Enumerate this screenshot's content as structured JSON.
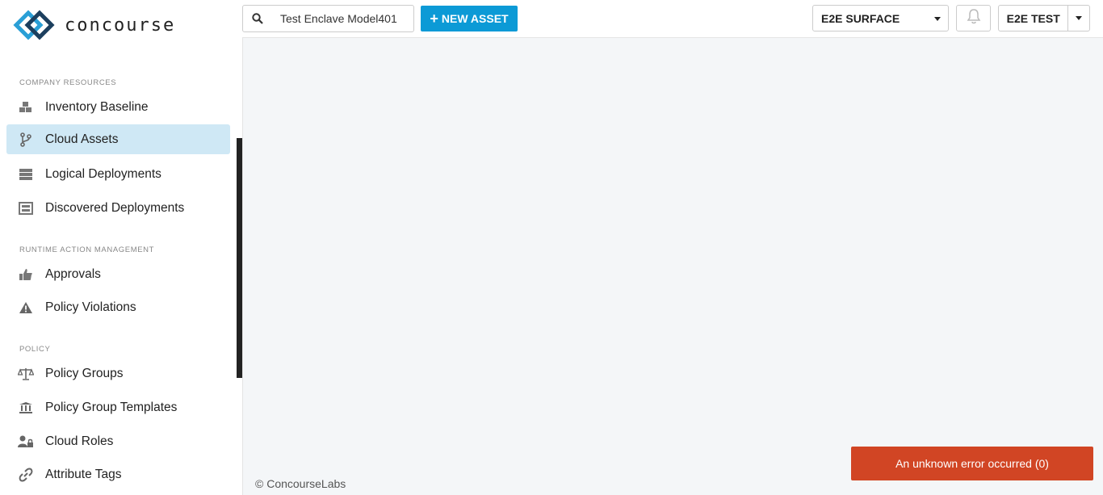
{
  "app": {
    "logo_text": "concourse"
  },
  "header": {
    "search_value": "Test Enclave Model401",
    "new_asset_label": "NEW ASSET",
    "surface_label": "E2E SURFACE",
    "user_label": "E2E TEST"
  },
  "sidebar": {
    "sections": {
      "company_resources": "COMPANY RESOURCES",
      "runtime_action_management": "RUNTIME ACTION MANAGEMENT",
      "policy": "POLICY"
    },
    "items": [
      {
        "label": "Inventory Baseline",
        "icon": "cubes-icon"
      },
      {
        "label": "Cloud Assets",
        "icon": "branch-icon",
        "active": true
      },
      {
        "label": "Logical Deployments",
        "icon": "server-icon"
      },
      {
        "label": "Discovered Deployments",
        "icon": "scan-icon"
      },
      {
        "label": "Approvals",
        "icon": "thumbs-up-icon"
      },
      {
        "label": "Policy Violations",
        "icon": "warning-icon"
      },
      {
        "label": "Policy Groups",
        "icon": "scale-icon"
      },
      {
        "label": "Policy Group Templates",
        "icon": "institution-icon"
      },
      {
        "label": "Cloud Roles",
        "icon": "user-lock-icon"
      },
      {
        "label": "Attribute Tags",
        "icon": "link-icon"
      }
    ]
  },
  "main": {
    "footer": "© ConcourseLabs",
    "toast": "An unknown error occurred (0)"
  },
  "colors": {
    "accent": "#0c9ad6",
    "active_nav": "#cfe8f5",
    "error": "#d14524",
    "logo_blue": "#2a9fd6",
    "logo_dark": "#1c3f5e"
  }
}
